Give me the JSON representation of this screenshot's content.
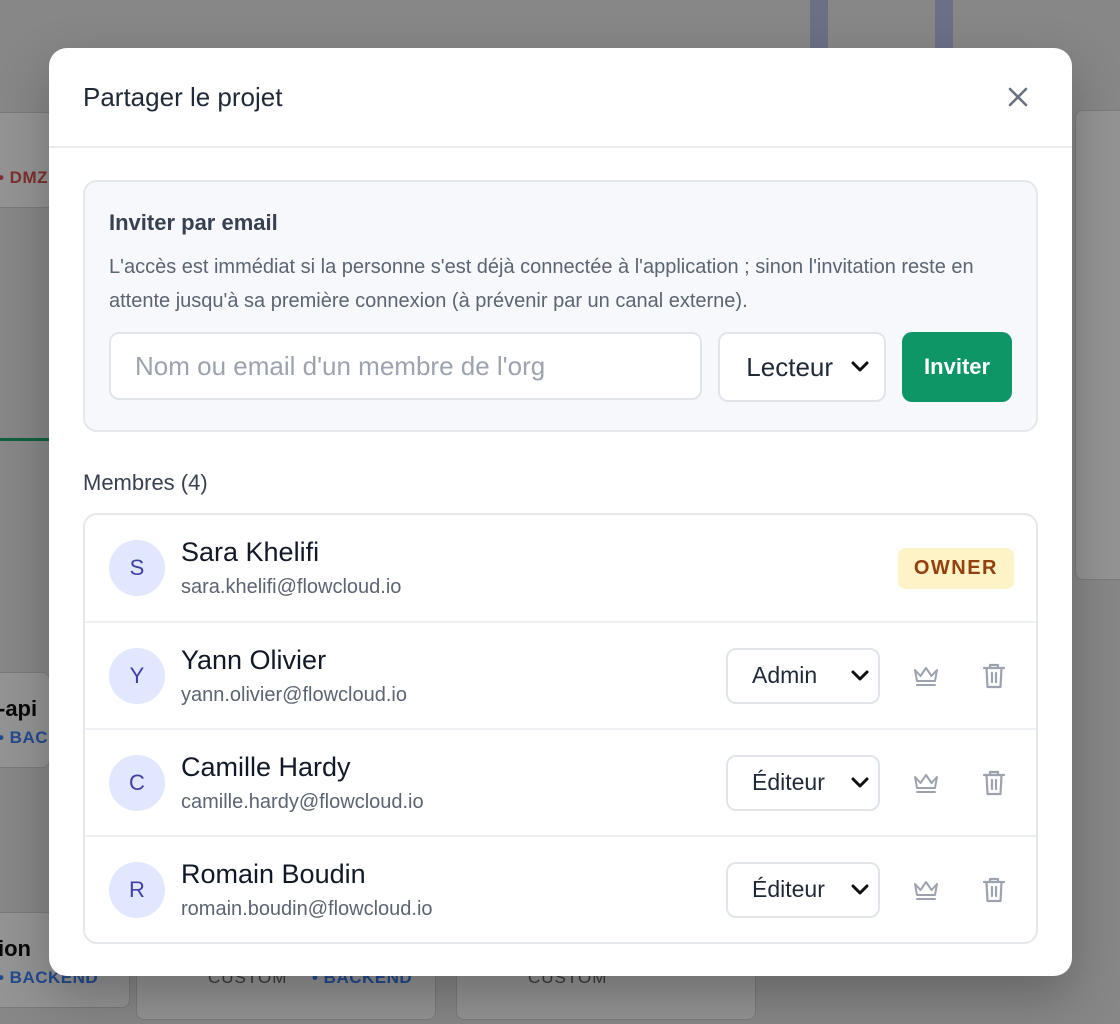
{
  "background": {
    "tags": {
      "dmz": "• DMZ",
      "backend_a": "• BACK",
      "backend_b": "• BACKEND",
      "backend_c": "• BACKEND"
    },
    "texts": {
      "api": "-api",
      "ion": "ion"
    },
    "custom": [
      "CUSTOM",
      "CUSTOM"
    ]
  },
  "modal": {
    "title": "Partager le projet",
    "close_icon": "close-icon"
  },
  "invite": {
    "title": "Inviter par email",
    "description": "L'accès est immédiat si la personne s'est déjà connectée à l'application ; sinon l'invitation reste en attente jusqu'à sa première connexion (à prévenir par un canal externe).",
    "input_placeholder": "Nom ou email d'un membre de l'org",
    "input_value": "",
    "role_selected": "Lecteur",
    "button_label": "Inviter"
  },
  "members": {
    "title": "Membres (4)",
    "list": [
      {
        "initial": "S",
        "name": "Sara Khelifi",
        "email": "sara.khelifi@flowcloud.io",
        "badge": "OWNER"
      },
      {
        "initial": "Y",
        "name": "Yann Olivier",
        "email": "yann.olivier@flowcloud.io",
        "role": "Admin"
      },
      {
        "initial": "C",
        "name": "Camille Hardy",
        "email": "camille.hardy@flowcloud.io",
        "role": "Éditeur"
      },
      {
        "initial": "R",
        "name": "Romain Boudin",
        "email": "romain.boudin@flowcloud.io",
        "role": "Éditeur"
      }
    ]
  },
  "colors": {
    "accent": "#0e9667",
    "avatar_bg": "#e0e7ff",
    "avatar_text": "#3f3fa8",
    "owner_bg": "#fef3c7",
    "owner_text": "#92400e"
  }
}
